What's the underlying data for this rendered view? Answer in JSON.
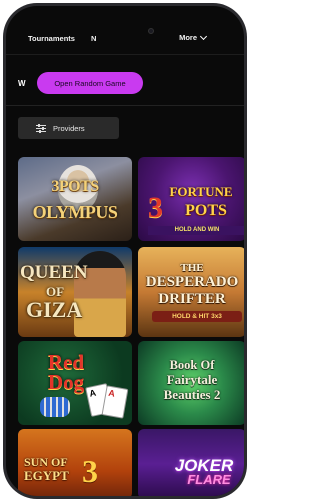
{
  "nav": {
    "tournaments": "Tournaments",
    "partial": "N",
    "more": "More"
  },
  "filters": {
    "w_label": "W",
    "random_game": "Open Random Game",
    "providers": "Providers"
  },
  "games": [
    {
      "line1": "3POTS",
      "line2": "OLYMPUS"
    },
    {
      "line1": "FORTUNE",
      "big": "3",
      "line2": "POTS",
      "band": "HOLD AND WIN"
    },
    {
      "line1": "QUEEN",
      "line2": "OF",
      "line3": "GIZA"
    },
    {
      "line1": "THE",
      "line2": "DESPERADO",
      "line3": "DRIFTER",
      "band": "HOLD & HIT 3x3"
    },
    {
      "line1": "Red",
      "line2": "Dog"
    },
    {
      "line1": "Book Of",
      "line2": "Fairytale",
      "line3": "Beauties 2"
    },
    {
      "line1": "SUN OF",
      "line2": "EGYPT",
      "big": "3"
    },
    {
      "line1": "JOKER",
      "line2": "FLARE"
    }
  ],
  "colors": {
    "accent": "#c93af0",
    "background": "#0a0a0a",
    "button_dark": "#2a2a2a"
  }
}
